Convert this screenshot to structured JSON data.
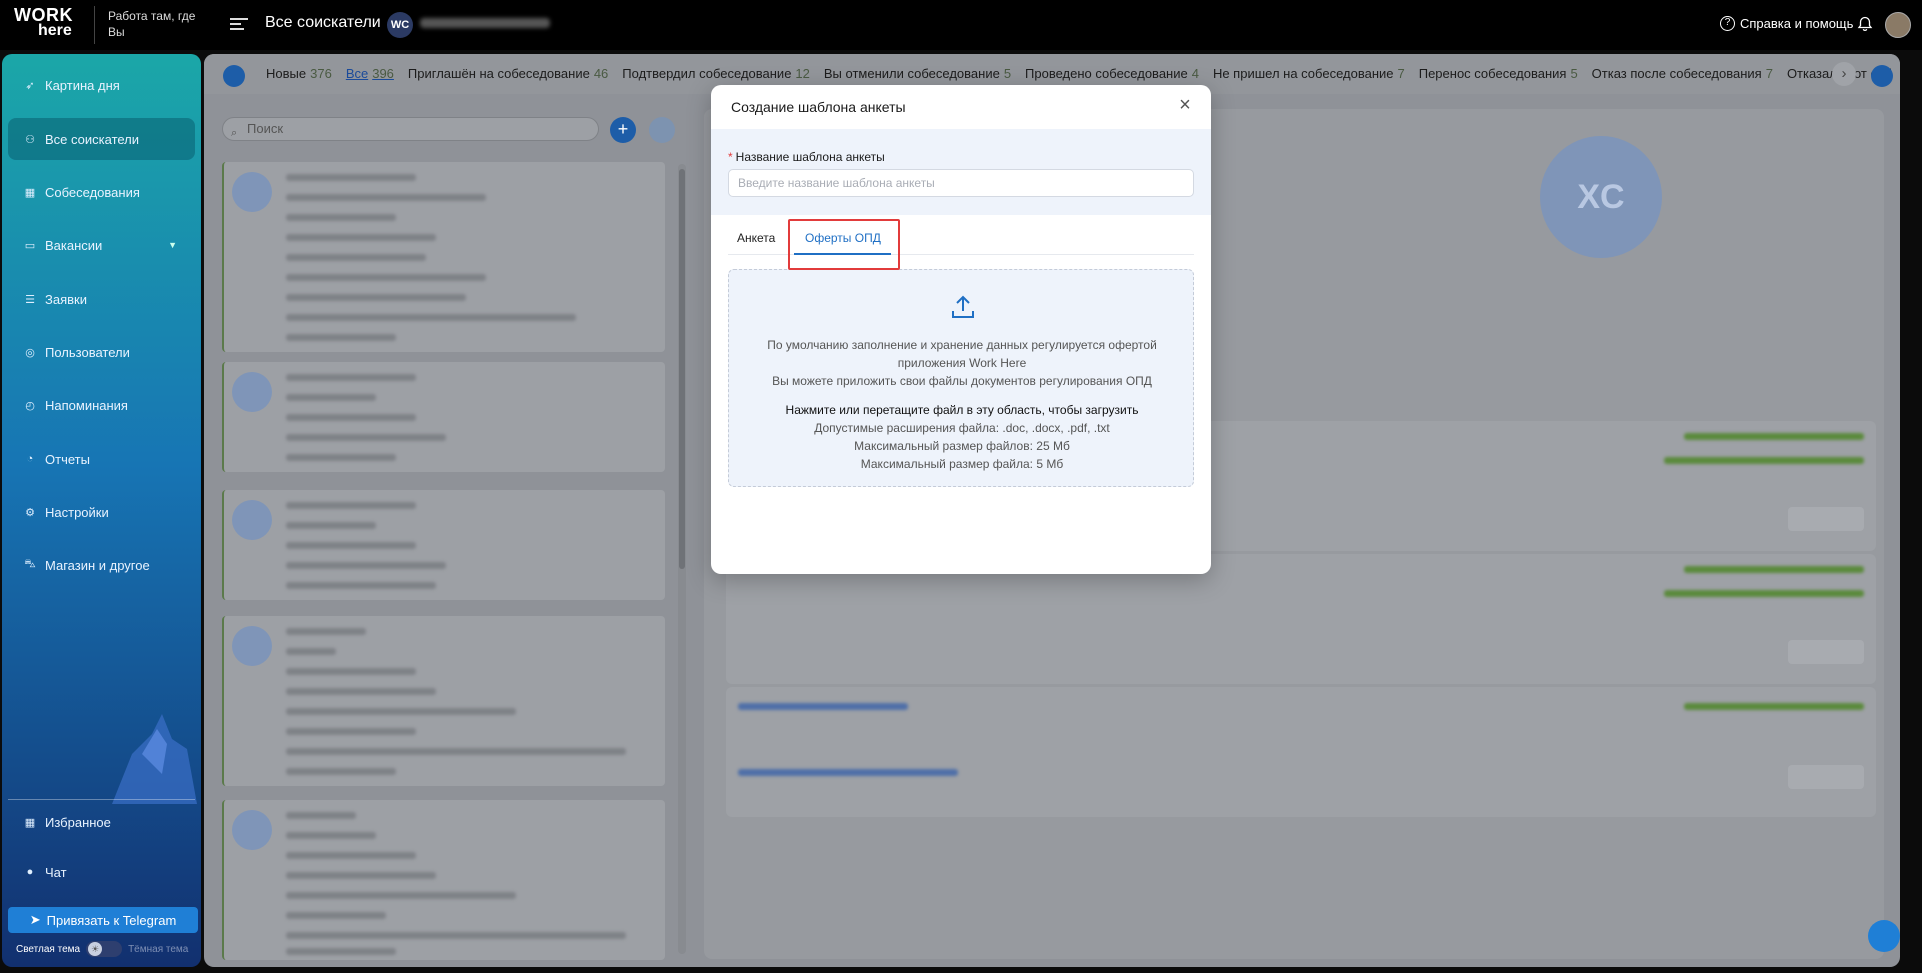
{
  "header": {
    "logo_line1": "WORK",
    "logo_line2": "here",
    "tagline": "Работа там, где Вы",
    "page_title": "Все соискатели",
    "org_badge": "WC",
    "help": "Справка и помощь"
  },
  "sidebar": {
    "items": [
      {
        "label": "Картина дня",
        "icon": "rocket-icon"
      },
      {
        "label": "Все соискатели",
        "icon": "users-icon"
      },
      {
        "label": "Собеседования",
        "icon": "calendar-icon"
      },
      {
        "label": "Вакансии",
        "icon": "briefcase-icon"
      },
      {
        "label": "Заявки",
        "icon": "list-icon"
      },
      {
        "label": "Пользователи",
        "icon": "user-circle-icon"
      },
      {
        "label": "Напоминания",
        "icon": "alarm-icon"
      },
      {
        "label": "Отчеты",
        "icon": "pie-chart-icon"
      },
      {
        "label": "Настройки",
        "icon": "gear-icon"
      },
      {
        "label": "Магазин и другое",
        "icon": "cart-icon"
      }
    ],
    "bottom_items": [
      {
        "label": "Избранное",
        "icon": "grid-icon"
      },
      {
        "label": "Чат",
        "icon": "chat-icon"
      }
    ],
    "telegram_button": "Привязать к Telegram",
    "theme_light": "Светлая тема",
    "theme_dark": "Тёмная тема"
  },
  "status_tabs": [
    {
      "label": "Новые",
      "count": "376"
    },
    {
      "label": "Все",
      "count": "396"
    },
    {
      "label": "Приглашён на собеседование",
      "count": "46"
    },
    {
      "label": "Подтвердил собеседование",
      "count": "12"
    },
    {
      "label": "Вы отменили собеседование",
      "count": "5"
    },
    {
      "label": "Проведено собеседование",
      "count": "4"
    },
    {
      "label": "Не пришел на собеседование",
      "count": "7"
    },
    {
      "label": "Перенос собеседования",
      "count": "5"
    },
    {
      "label": "Отказ после собеседования",
      "count": "7"
    },
    {
      "label": "Отказался от соб",
      "count": ""
    }
  ],
  "search": {
    "placeholder": "Поиск"
  },
  "detail": {
    "avatar_initials": "XC"
  },
  "modal": {
    "title": "Создание шаблона анкеты",
    "name_label": "Название шаблона анкеты",
    "name_placeholder": "Введите название шаблона анкеты",
    "tabs": [
      "Анкета",
      "Оферты ОПД"
    ],
    "active_tab": "Оферты ОПД",
    "dropzone": {
      "line1": "По умолчанию заполнение и хранение данных регулируется офертой приложения Work Here",
      "line2": "Вы можете приложить свои файлы документов регулирования ОПД",
      "cta": "Нажмите или перетащите файл в эту область, чтобы загрузить",
      "extensions": "Допустимые расширения файла: .doc, .docx, .pdf, .txt",
      "max_total": "Максимальный размер файлов: 25 Мб",
      "max_file": "Максимальный размер файла: 5 Мб"
    }
  },
  "colors": {
    "accent": "#1f6fc4",
    "highlight": "#e23b3b",
    "sidebar_top": "#1ba7a8",
    "sidebar_bottom": "#12306f"
  }
}
